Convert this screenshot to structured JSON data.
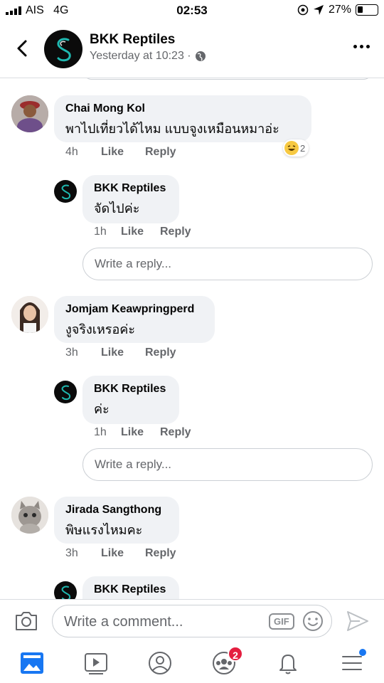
{
  "status": {
    "carrier": "AIS",
    "network": "4G",
    "time": "02:53",
    "battery": "27%"
  },
  "header": {
    "page_name": "BKK Reptiles",
    "subtitle": "Yesterday at 10:23 ·"
  },
  "comments": [
    {
      "name": "Chai Mong Kol",
      "text": "พาไปเที่ยวได้ไหม แบบจูงเหมือนหมาอ่ะ",
      "time": "4h",
      "like": "Like",
      "reply": "Reply",
      "reaction_count": "2",
      "reply_item": {
        "name": "BKK Reptiles",
        "text": "จัดไปค่ะ",
        "time": "1h",
        "like": "Like",
        "reply": "Reply"
      }
    },
    {
      "name": "Jomjam Keawpringperd",
      "text": "งูจริงเหรอค่ะ",
      "time": "3h",
      "like": "Like",
      "reply": "Reply",
      "reply_item": {
        "name": "BKK Reptiles",
        "text": "ค่ะ",
        "time": "1h",
        "like": "Like",
        "reply": "Reply"
      }
    },
    {
      "name": "Jirada Sangthong",
      "text": "พิษแรงไหมคะ",
      "time": "3h",
      "like": "Like",
      "reply": "Reply",
      "reply_item": {
        "name": "BKK Reptiles"
      }
    }
  ],
  "reply_placeholder": "Write a reply...",
  "composer": {
    "placeholder": "Write a comment...",
    "gif_label": "GIF"
  },
  "nav": {
    "groups_badge": "2"
  },
  "colors": {
    "bubble": "#f0f2f5",
    "muted": "#65676b",
    "badge": "#e41e3f",
    "accent": "#1877f2"
  },
  "icons": [
    "signal-icon",
    "location-icon",
    "battery-icon",
    "back-icon",
    "globe-icon",
    "more-icon",
    "camera-icon",
    "gif-icon",
    "emoji-icon",
    "send-icon",
    "news-feed-icon",
    "watch-icon",
    "profile-icon",
    "groups-icon",
    "bell-icon",
    "menu-icon"
  ]
}
